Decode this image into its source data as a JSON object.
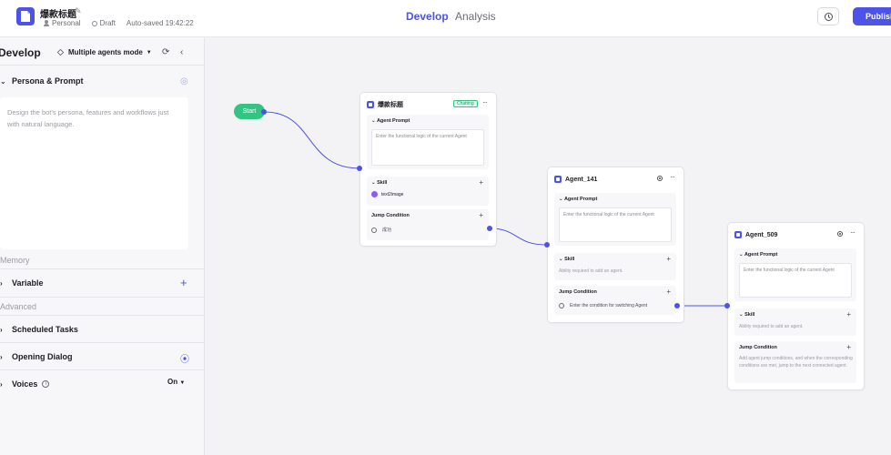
{
  "header": {
    "bot_name": "爆款标题",
    "meta": {
      "space": "Personal",
      "status": "Draft",
      "autosave": "Auto-saved 19:42:22"
    },
    "tabs": [
      {
        "label": "Develop",
        "active": true
      },
      {
        "label": "Analysis",
        "active": false
      }
    ],
    "publish_label": "Publish",
    "accent_color": "#4d53e8"
  },
  "left_panel": {
    "title": "Develop",
    "mode_label": "Multiple agents mode",
    "persona": {
      "title": "Persona & Prompt",
      "placeholder": "Design the bot's persona, features and workflows just with natural language."
    },
    "groups": [
      {
        "label": "Memory",
        "items": [
          {
            "label": "Variable"
          }
        ]
      },
      {
        "label": "Advanced",
        "items": [
          {
            "label": "Scheduled Tasks"
          },
          {
            "label": "Opening Dialog"
          },
          {
            "label": "Voices",
            "value": "On"
          }
        ]
      }
    ]
  },
  "canvas": {
    "start_label": "Start",
    "nodes": [
      {
        "name": "爆款标题",
        "badge": "Chatting",
        "agent_prompt_title": "Agent Prompt",
        "agent_prompt_placeholder": "Enter the functional logic of the current Agent",
        "skill_title": "Skill",
        "skill_item": "text2image",
        "jump_title": "Jump Condition",
        "jump_value": "成功"
      },
      {
        "name": "Agent_141",
        "agent_prompt_title": "Agent Prompt",
        "agent_prompt_placeholder": "Enter the functional logic of the current Agent",
        "skill_title": "Skill",
        "skill_empty": "Ability required to add an agent.",
        "jump_title": "Jump Condition",
        "jump_placeholder": "Enter the condition for switching Agent"
      },
      {
        "name": "Agent_509",
        "agent_prompt_title": "Agent Prompt",
        "agent_prompt_placeholder": "Enter the functional logic of the current Agent",
        "skill_title": "Skill",
        "skill_empty": "Ability required to add an agent.",
        "jump_title": "Jump Condition",
        "jump_placeholder": "Add agent jump conditions, and when the corresponding conditions are met, jump to the next connected agent."
      }
    ]
  }
}
